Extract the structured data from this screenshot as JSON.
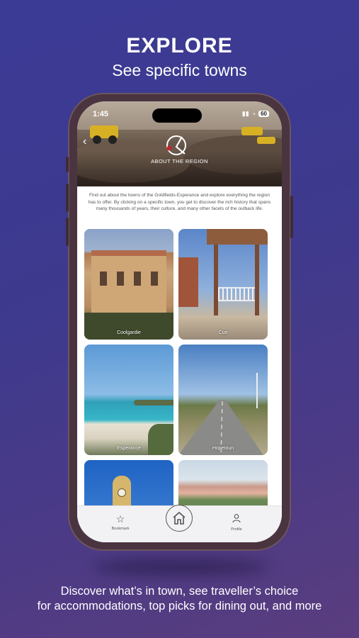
{
  "headline": {
    "title": "EXPLORE",
    "subtitle": "See specific towns"
  },
  "footer": {
    "line1": "Discover what’s in town, see traveller’s choice",
    "line2": "for accommodations, top picks for dining out, and more"
  },
  "status_bar": {
    "time": "1:45",
    "battery": "60"
  },
  "hero": {
    "label": "ABOUT THE REGION",
    "back_icon": "chevron-left-icon"
  },
  "intro_text": "Find out about the towns of the Goldfields-Esperance and explore everything the region has to offer. By clicking on a specific town, you get to discover the rich history that spans many thousands of years, their culture, and many other facets of the outback life.",
  "towns": [
    {
      "name": "Coolgardie"
    },
    {
      "name": "Cue"
    },
    {
      "name": "Esperance"
    },
    {
      "name": "Hopetoun"
    },
    {
      "name": ""
    },
    {
      "name": ""
    }
  ],
  "tabbar": {
    "bookmark": {
      "label": "Bookmark",
      "icon": "star-icon"
    },
    "home": {
      "icon": "home-icon"
    },
    "profile": {
      "label": "Profile",
      "icon": "person-icon"
    }
  },
  "colors": {
    "background": "#3b3a95",
    "brand_red": "#c0262d"
  }
}
